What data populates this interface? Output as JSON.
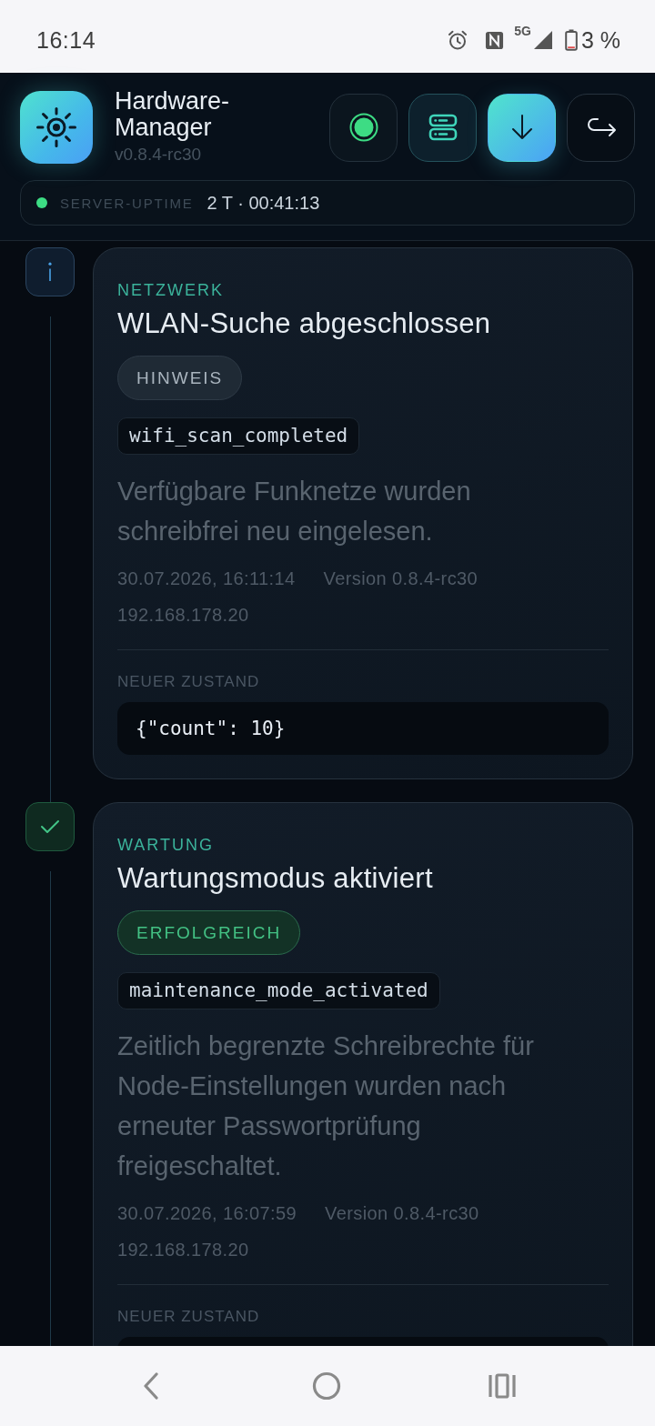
{
  "status_bar": {
    "time": "16:14",
    "network": "5G",
    "battery": "3 %"
  },
  "app": {
    "title": "Hardware-Manager",
    "version": "v0.8.4-rc30"
  },
  "uptime": {
    "label": "SERVER-UPTIME",
    "value": "2 T · 00:41:13",
    "online": true
  },
  "events": [
    {
      "kind": "info",
      "category": "NETZWERK",
      "title": "WLAN-Suche abgeschlossen",
      "badge": "HINWEIS",
      "code": "wifi_scan_completed",
      "description": "Verfügbare Funknetze wurden schreibfrei neu eingelesen.",
      "timestamp": "30.07.2026, 16:11:14",
      "version": "Version 0.8.4-rc30",
      "ip": "192.168.178.20",
      "state_label": "NEUER ZUSTAND",
      "state": "{\"count\": 10}"
    },
    {
      "kind": "success",
      "category": "WARTUNG",
      "title": "Wartungsmodus aktiviert",
      "badge": "ERFOLGREICH",
      "code": "maintenance_mode_activated",
      "description": "Zeitlich begrenzte Schreibrechte für Node-Einstellungen wurden nach erneuter Passwortprüfung freigeschaltet.",
      "timestamp": "30.07.2026, 16:07:59",
      "version": "Version 0.8.4-rc30",
      "ip": "192.168.178.20",
      "state_label": "NEUER ZUSTAND"
    }
  ]
}
